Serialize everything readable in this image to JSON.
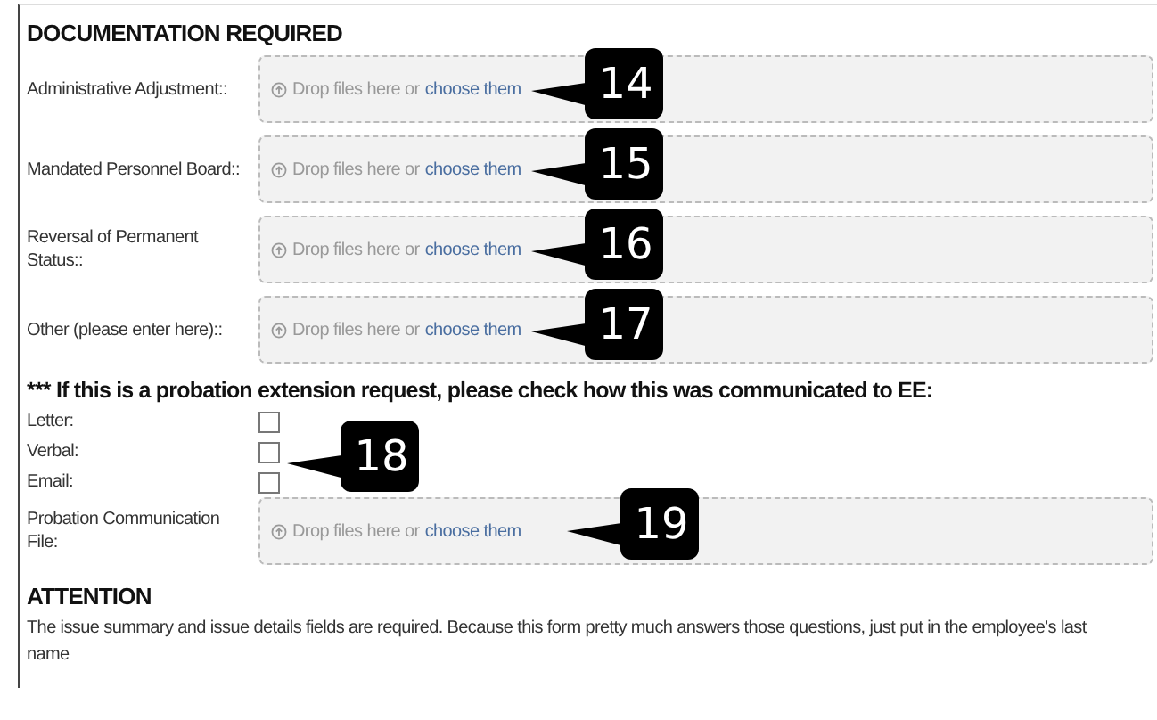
{
  "heading": "DOCUMENTATION REQUIRED",
  "upload_fields": [
    {
      "label": "Administrative Adjustment::",
      "hint": "Drop files here or",
      "link": "choose them",
      "callout": "14"
    },
    {
      "label": "Mandated Personnel Board::",
      "hint": "Drop files here or",
      "link": "choose them",
      "callout": "15"
    },
    {
      "label": "Reversal of Permanent Status::",
      "hint": "Drop files here or",
      "link": "choose them",
      "callout": "16"
    },
    {
      "label": "Other (please enter here)::",
      "hint": "Drop files here or",
      "link": "choose them",
      "callout": "17"
    }
  ],
  "probation": {
    "question": "*** If this is a probation extension request, please check how this was communicated to EE:",
    "options": [
      {
        "label": "Letter:",
        "checked": false
      },
      {
        "label": "Verbal:",
        "checked": false
      },
      {
        "label": "Email:",
        "checked": false
      }
    ],
    "callout": "18",
    "file": {
      "label": "Probation Communication File:",
      "hint": "Drop files here or",
      "link": "choose them",
      "callout": "19"
    }
  },
  "attention": {
    "title": "ATTENTION",
    "text": "The issue summary and issue details fields are required. Because this form pretty much answers those questions, just put in the employee's last name"
  }
}
